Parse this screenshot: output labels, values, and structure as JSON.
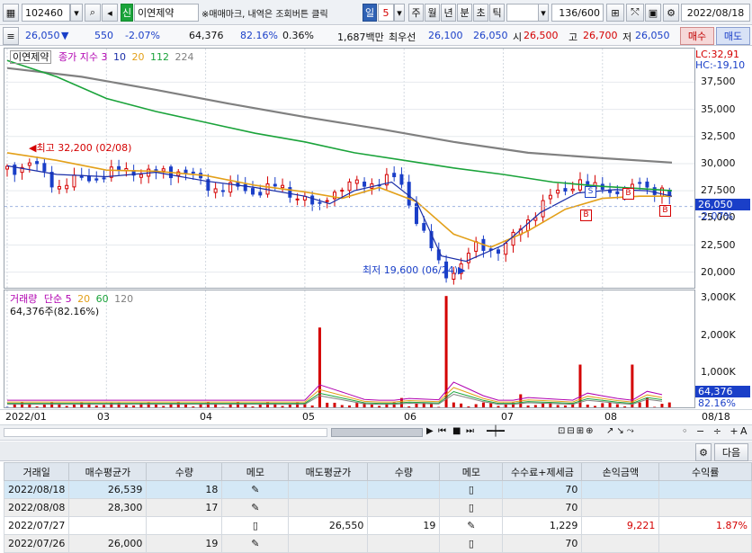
{
  "toolbar": {
    "code": "102460",
    "credit_badge": "신",
    "stock_name": "이연제약",
    "notice": "※매매마크, 내역은 조회버튼 클릭",
    "period_tabs": [
      "일",
      "5",
      "주",
      "월",
      "년",
      "분",
      "초",
      "틱"
    ],
    "count": "136/600",
    "date": "2022/08/18"
  },
  "quote": {
    "price": "26,050",
    "change": "550",
    "change_pct": "-2.07%",
    "volume": "64,376",
    "vol_ratio": "82.16%",
    "turnover": "0.36%",
    "amount": "1,687백만",
    "best_label": "최우선",
    "best_bid": "26,100",
    "best_ask": "26,050",
    "open_label": "시",
    "open": "26,500",
    "high_label": "고",
    "high": "26,700",
    "low_label": "저",
    "low": "26,050",
    "buy_label": "매수",
    "sell_label": "매도"
  },
  "price_legend": {
    "name": "이연제약",
    "kind": "종가 지수 3",
    "ma1": "10",
    "ma2": "20",
    "ma3": "112",
    "ma4": "224"
  },
  "volume_legend": {
    "name": "거래량",
    "kind": "단순 5",
    "ma1": "20",
    "ma2": "60",
    "ma3": "120",
    "current": "64,376주(82.16%)"
  },
  "annotations": {
    "high_marker": "최고 32,200 (02/08)",
    "low_marker": "최저 19,600 (06/24)",
    "lc": "LC:32,91",
    "hc": "HC:-19,10",
    "current_price": "26,050",
    "current_pct": "-2.07%",
    "current_vol": "64,376",
    "current_vol_pct": "82.16%",
    "trade_marks": [
      "S",
      "B",
      "B",
      "B"
    ]
  },
  "colors": {
    "up": "#d40000",
    "down": "#1a3fc8",
    "ma10": "#1a2ea8",
    "ma20": "#e3a019",
    "ma112": "#1aa33a",
    "ma224": "#808080"
  },
  "chart_data": [
    {
      "type": "candlestick",
      "y_ticks": [
        "37,500",
        "35,000",
        "32,500",
        "30,000",
        "27,500",
        "25,000",
        "22,500",
        "20,000"
      ],
      "ylim": [
        18400,
        40600
      ],
      "x_ticks": [
        "2022/01",
        "03",
        "04",
        "05",
        "06",
        "07",
        "08",
        "08/18"
      ],
      "close_points": [
        {
          "d": 0,
          "v": 29500
        },
        {
          "d": 10,
          "v": 30000
        },
        {
          "d": 20,
          "v": 28000
        },
        {
          "d": 30,
          "v": 28500
        },
        {
          "d": 40,
          "v": 29000
        },
        {
          "d": 50,
          "v": 29500
        },
        {
          "d": 60,
          "v": 29000
        },
        {
          "d": 70,
          "v": 29500
        },
        {
          "d": 80,
          "v": 28000
        },
        {
          "d": 90,
          "v": 27700
        },
        {
          "d": 100,
          "v": 27500
        },
        {
          "d": 110,
          "v": 27800
        },
        {
          "d": 120,
          "v": 26800
        },
        {
          "d": 125,
          "v": 25500
        },
        {
          "d": 130,
          "v": 27500
        },
        {
          "d": 140,
          "v": 28000
        },
        {
          "d": 150,
          "v": 28500
        },
        {
          "d": 158,
          "v": 28500
        },
        {
          "d": 163,
          "v": 26000
        },
        {
          "d": 170,
          "v": 22500
        },
        {
          "d": 176,
          "v": 19800
        },
        {
          "d": 182,
          "v": 20500
        },
        {
          "d": 190,
          "v": 22500
        },
        {
          "d": 200,
          "v": 22000
        },
        {
          "d": 210,
          "v": 25000
        },
        {
          "d": 220,
          "v": 27000
        },
        {
          "d": 230,
          "v": 28500
        },
        {
          "d": 235,
          "v": 27500
        },
        {
          "d": 240,
          "v": 28000
        },
        {
          "d": 245,
          "v": 27500
        },
        {
          "d": 250,
          "v": 26800
        },
        {
          "d": 255,
          "v": 28500
        },
        {
          "d": 260,
          "v": 27700
        },
        {
          "d": 265,
          "v": 27400
        },
        {
          "d": 268,
          "v": 26050
        }
      ],
      "ma_points": {
        "ma10": [
          {
            "d": 0,
            "v": 29800
          },
          {
            "d": 20,
            "v": 29000
          },
          {
            "d": 40,
            "v": 28800
          },
          {
            "d": 60,
            "v": 29200
          },
          {
            "d": 80,
            "v": 28400
          },
          {
            "d": 100,
            "v": 27800
          },
          {
            "d": 120,
            "v": 27000
          },
          {
            "d": 130,
            "v": 26300
          },
          {
            "d": 140,
            "v": 27500
          },
          {
            "d": 155,
            "v": 28300
          },
          {
            "d": 165,
            "v": 26500
          },
          {
            "d": 175,
            "v": 21500
          },
          {
            "d": 185,
            "v": 21000
          },
          {
            "d": 200,
            "v": 22500
          },
          {
            "d": 215,
            "v": 25500
          },
          {
            "d": 230,
            "v": 27300
          },
          {
            "d": 245,
            "v": 27600
          },
          {
            "d": 258,
            "v": 27500
          },
          {
            "d": 268,
            "v": 27000
          }
        ],
        "ma20": [
          {
            "d": 0,
            "v": 31000
          },
          {
            "d": 20,
            "v": 30300
          },
          {
            "d": 40,
            "v": 29400
          },
          {
            "d": 60,
            "v": 29300
          },
          {
            "d": 80,
            "v": 28900
          },
          {
            "d": 100,
            "v": 28000
          },
          {
            "d": 120,
            "v": 27400
          },
          {
            "d": 135,
            "v": 26800
          },
          {
            "d": 150,
            "v": 27800
          },
          {
            "d": 165,
            "v": 26500
          },
          {
            "d": 180,
            "v": 23500
          },
          {
            "d": 195,
            "v": 22300
          },
          {
            "d": 210,
            "v": 23800
          },
          {
            "d": 225,
            "v": 25800
          },
          {
            "d": 240,
            "v": 26800
          },
          {
            "d": 255,
            "v": 27000
          },
          {
            "d": 268,
            "v": 27000
          }
        ],
        "ma112": [
          {
            "d": 0,
            "v": 39500
          },
          {
            "d": 20,
            "v": 38000
          },
          {
            "d": 40,
            "v": 36000
          },
          {
            "d": 60,
            "v": 34800
          },
          {
            "d": 80,
            "v": 33800
          },
          {
            "d": 100,
            "v": 32800
          },
          {
            "d": 120,
            "v": 32000
          },
          {
            "d": 140,
            "v": 31000
          },
          {
            "d": 160,
            "v": 30300
          },
          {
            "d": 180,
            "v": 29600
          },
          {
            "d": 200,
            "v": 29000
          },
          {
            "d": 220,
            "v": 28300
          },
          {
            "d": 240,
            "v": 27900
          },
          {
            "d": 255,
            "v": 27700
          },
          {
            "d": 268,
            "v": 27500
          }
        ],
        "ma224": [
          {
            "d": 0,
            "v": 38800
          },
          {
            "d": 30,
            "v": 38000
          },
          {
            "d": 60,
            "v": 36800
          },
          {
            "d": 90,
            "v": 35500
          },
          {
            "d": 120,
            "v": 34300
          },
          {
            "d": 150,
            "v": 33200
          },
          {
            "d": 180,
            "v": 32000
          },
          {
            "d": 210,
            "v": 31000
          },
          {
            "d": 240,
            "v": 30500
          },
          {
            "d": 268,
            "v": 30100
          }
        ]
      }
    },
    {
      "type": "bar",
      "y_ticks": [
        "3,000K",
        "2,000K",
        "1,000K"
      ],
      "ylim": [
        0,
        3200000
      ],
      "spikes": [
        {
          "d": 125,
          "v": 2200000
        },
        {
          "d": 158,
          "v": 300000
        },
        {
          "d": 176,
          "v": 3050000
        },
        {
          "d": 208,
          "v": 400000
        },
        {
          "d": 230,
          "v": 1200000
        },
        {
          "d": 253,
          "v": 1200000
        },
        {
          "d": 258,
          "v": 300000
        }
      ],
      "baseline": 120000
    }
  ],
  "table": {
    "headers": [
      "거래일",
      "매수평균가",
      "수량",
      "메모",
      "매도평균가",
      "수량",
      "메모",
      "수수료+제세금",
      "손익금액",
      "수익률"
    ],
    "rows": [
      [
        "2022/08/18",
        "26,539",
        "18",
        "",
        "",
        "",
        "",
        "70",
        "",
        ""
      ],
      [
        "2022/08/08",
        "28,300",
        "17",
        "",
        "",
        "",
        "",
        "70",
        "",
        ""
      ],
      [
        "2022/07/27",
        "",
        "",
        "",
        "26,550",
        "19",
        "",
        "1,229",
        "9,221",
        "1.87%"
      ],
      [
        "2022/07/26",
        "26,000",
        "19",
        "",
        "",
        "",
        "",
        "70",
        "",
        ""
      ]
    ]
  },
  "next_label": "다음"
}
